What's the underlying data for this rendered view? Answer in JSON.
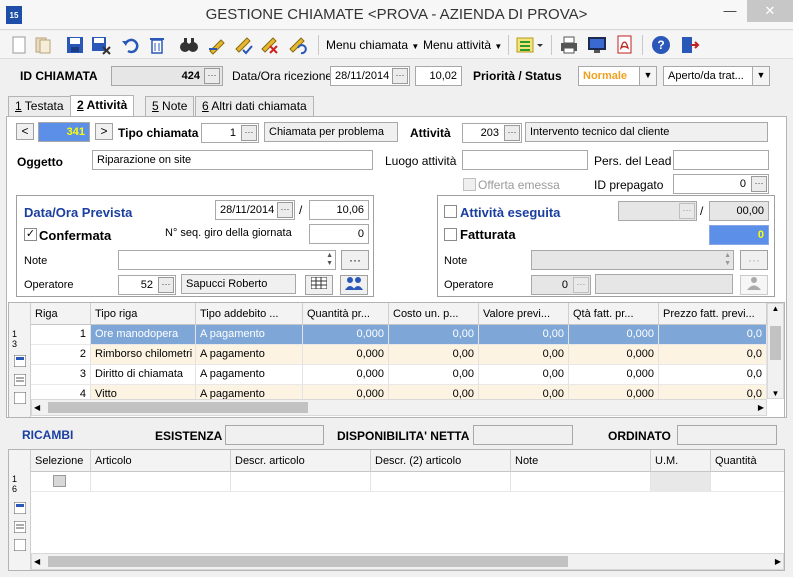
{
  "window": {
    "title": "GESTIONE CHIAMATE <PROVA - AZIENDA DI PROVA>",
    "app_badge": "15",
    "controls": {
      "minimize": "—",
      "maximize": "☐",
      "close": "✕"
    }
  },
  "toolbar": {
    "icons": [
      "new-icon",
      "open-icon",
      "save-icon",
      "save-close-icon",
      "undo-icon",
      "delete-icon",
      "search-icon",
      "edit-icon",
      "edit-check-icon",
      "edit-delete-icon",
      "edit-undo-icon"
    ],
    "menu_chiamata": "Menu chiamata",
    "menu_attivita": "Menu attività",
    "right_icons": [
      "list-options-icon",
      "print-icon",
      "monitor-icon",
      "pdf-icon",
      "help-icon",
      "exit-icon"
    ]
  },
  "header": {
    "id_label": "ID CHIAMATA",
    "id_value": "424",
    "data_label": "Data/Ora ricezione",
    "data_value": "28/11/2014",
    "ora_value": "10,02",
    "priority_label": "Priorità / Status",
    "priority_value": "Normale",
    "status_value": "Aperto/da trat...",
    "priority_color": "#f0a020"
  },
  "tabs": [
    {
      "num": "1",
      "label": " Testata"
    },
    {
      "num": "2",
      "label": " Attività"
    },
    {
      "num": "5",
      "label": " Note"
    },
    {
      "num": "6",
      "label": " Altri dati chiamata"
    }
  ],
  "activity": {
    "nav_prev": "<",
    "nav_next": ">",
    "index": "341",
    "index_color": "#5b8fe8",
    "tipo_label": "Tipo chiamata",
    "tipo_code": "1",
    "tipo_desc": "Chiamata per problema",
    "attivita_label": "Attività",
    "attivita_code": "203",
    "attivita_desc": "Intervento tecnico dal cliente",
    "oggetto_label": "Oggetto",
    "oggetto_value": "Riparazione on site",
    "luogo_label": "Luogo attività",
    "luogo_value": "",
    "pers_label": "Pers. del Lead",
    "pers_value": "",
    "offerta_label": "Offerta emessa",
    "prepagato_label": "ID prepagato",
    "prepagato_value": "0"
  },
  "prevista": {
    "title": "Data/Ora Prevista",
    "date": "28/11/2014",
    "slash": "/",
    "time": "10,06",
    "confermata_label": "Confermata",
    "confermata_check": "✓",
    "seq_label": "N° seq. giro della giornata",
    "seq_value": "0",
    "note_label": "Note",
    "note_value": "",
    "operatore_label": "Operatore",
    "operatore_code": "52",
    "operatore_name": "Sapucci Roberto"
  },
  "eseguita": {
    "title": "Attività eseguita",
    "slash": "/",
    "time": "00,00",
    "fatturata_label": "Fatturata",
    "fatturata_value": "0",
    "fatturata_color": "#5b8fe8",
    "note_label": "Note",
    "operatore_label": "Operatore",
    "operatore_code": "0"
  },
  "righe_grid": {
    "headers": [
      "Riga",
      "Tipo riga",
      "Tipo addebito ...",
      "Quantità pr...",
      "Costo un. p...",
      "Valore previ...",
      "Qtà fatt. pr...",
      "Prezzo fatt. previ..."
    ],
    "rows": [
      [
        "1",
        "Ore manodopera",
        "A pagamento",
        "0,000",
        "0,00",
        "0,00",
        "0,000",
        "0,0"
      ],
      [
        "2",
        "Rimborso chilometri",
        "A pagamento",
        "0,000",
        "0,00",
        "0,00",
        "0,000",
        "0,0"
      ],
      [
        "3",
        "Diritto di chiamata",
        "A pagamento",
        "0,000",
        "0,00",
        "0,00",
        "0,000",
        "0,0"
      ],
      [
        "4",
        "Vitto",
        "A pagamento",
        "0,000",
        "0,00",
        "0,00",
        "0,000",
        "0,0"
      ]
    ],
    "counter_top": "1",
    "counter_bottom": "3"
  },
  "ricambi": {
    "label": "RICAMBI",
    "esistenza_label": "ESISTENZA",
    "disponibilita_label": "DISPONIBILITA' NETTA",
    "ordinato_label": "ORDINATO",
    "headers": [
      "Selezione",
      "Articolo",
      "Descr. articolo",
      "Descr. (2) articolo",
      "Note",
      "U.M.",
      "Quantità"
    ],
    "counter_top": "1",
    "counter_bottom": "6"
  }
}
